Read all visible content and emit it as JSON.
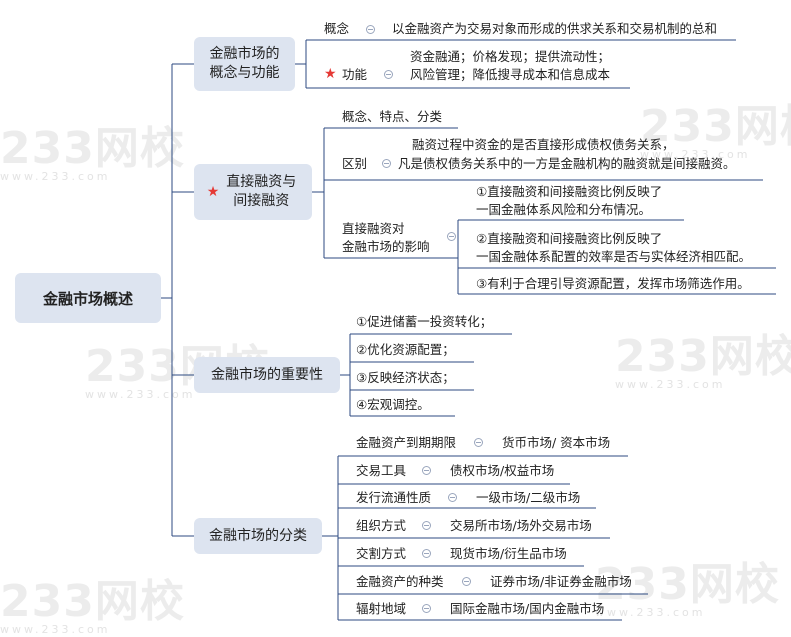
{
  "colors": {
    "node_fill": "#dde4f0",
    "line": "#2c4a80",
    "star": "#e53935",
    "watermark": "#ececec"
  },
  "watermark": {
    "logo_text": "233网校",
    "sub_text": "www.233.com"
  },
  "root": {
    "label": "金融市场概述"
  },
  "branches": {
    "concept": {
      "label": "金融市场的概念与功能",
      "concept_label": "概念",
      "concept_text": "以金融资产为交易对象而形成的供求关系和交易机制的总和",
      "function_label": "功能",
      "function_icon": "star-icon",
      "function_lines": [
        "资金融通；价格发现；提供流动性；",
        "风险管理；降低搜寻成本和信息成本"
      ]
    },
    "financing": {
      "label": "直接融资与间接融资",
      "label_icon": "star-icon",
      "sub1": "概念、特点、分类",
      "diff_label": "区别",
      "diff_lines": [
        "融资过程中资金的是否直接形成债权债务关系，",
        "凡是债权债务关系中的一方是金融机构的融资就是间接融资。"
      ],
      "impact_label_lines": [
        "直接融资对",
        "金融市场的影响"
      ],
      "impact_items": [
        [
          "①直接融资和间接融资比例反映了",
          "一国金融体系风险和分布情况。"
        ],
        [
          "②直接融资和间接融资比例反映了",
          "一国金融体系配置的效率是否与实体经济相匹配。"
        ],
        [
          "③有利于合理引导资源配置，发挥市场筛选作用。"
        ]
      ]
    },
    "importance": {
      "label": "金融市场的重要性",
      "items": [
        "①促进储蓄一投资转化；",
        "②优化资源配置；",
        "③反映经济状态；",
        "④宏观调控。"
      ]
    },
    "classification": {
      "label": "金融市场的分类",
      "rows": [
        {
          "criterion": "金融资产到期期限",
          "types": "货币市场/ 资本市场"
        },
        {
          "criterion": "交易工具",
          "types": "债权市场/权益市场"
        },
        {
          "criterion": "发行流通性质",
          "types": "一级市场/二级市场"
        },
        {
          "criterion": "组织方式",
          "types": "交易所市场/场外交易市场"
        },
        {
          "criterion": "交割方式",
          "types": "现货市场/衍生品市场"
        },
        {
          "criterion": "金融资产的种类",
          "types": "证券市场/非证券金融市场"
        },
        {
          "criterion": "辐射地域",
          "types": "国际金融市场/国内金融市场"
        }
      ]
    }
  }
}
